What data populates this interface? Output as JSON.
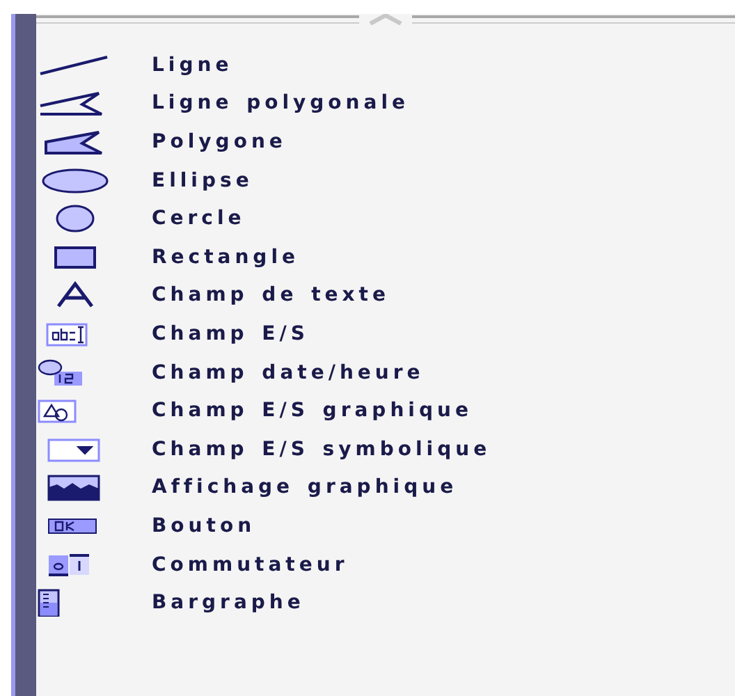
{
  "items": [
    {
      "label": "Ligne",
      "kind": "line"
    },
    {
      "label": "Ligne polygonale",
      "kind": "polyline"
    },
    {
      "label": "Polygone",
      "kind": "polygon"
    },
    {
      "label": "Ellipse",
      "kind": "ellipse"
    },
    {
      "label": "Cercle",
      "kind": "circle"
    },
    {
      "label": "Rectangle",
      "kind": "rectangle"
    },
    {
      "label": "Champ de texte",
      "kind": "text"
    },
    {
      "label": "Champ E/S",
      "kind": "io"
    },
    {
      "label": "Champ date/heure",
      "kind": "datetime"
    },
    {
      "label": "Champ E/S graphique",
      "kind": "graphic-io"
    },
    {
      "label": "Champ E/S symbolique",
      "kind": "symbolic-io"
    },
    {
      "label": "Affichage graphique",
      "kind": "graphic-view"
    },
    {
      "label": "Bouton",
      "kind": "button"
    },
    {
      "label": "Commutateur",
      "kind": "switch"
    },
    {
      "label": "Bargraphe",
      "kind": "bargraph"
    }
  ]
}
